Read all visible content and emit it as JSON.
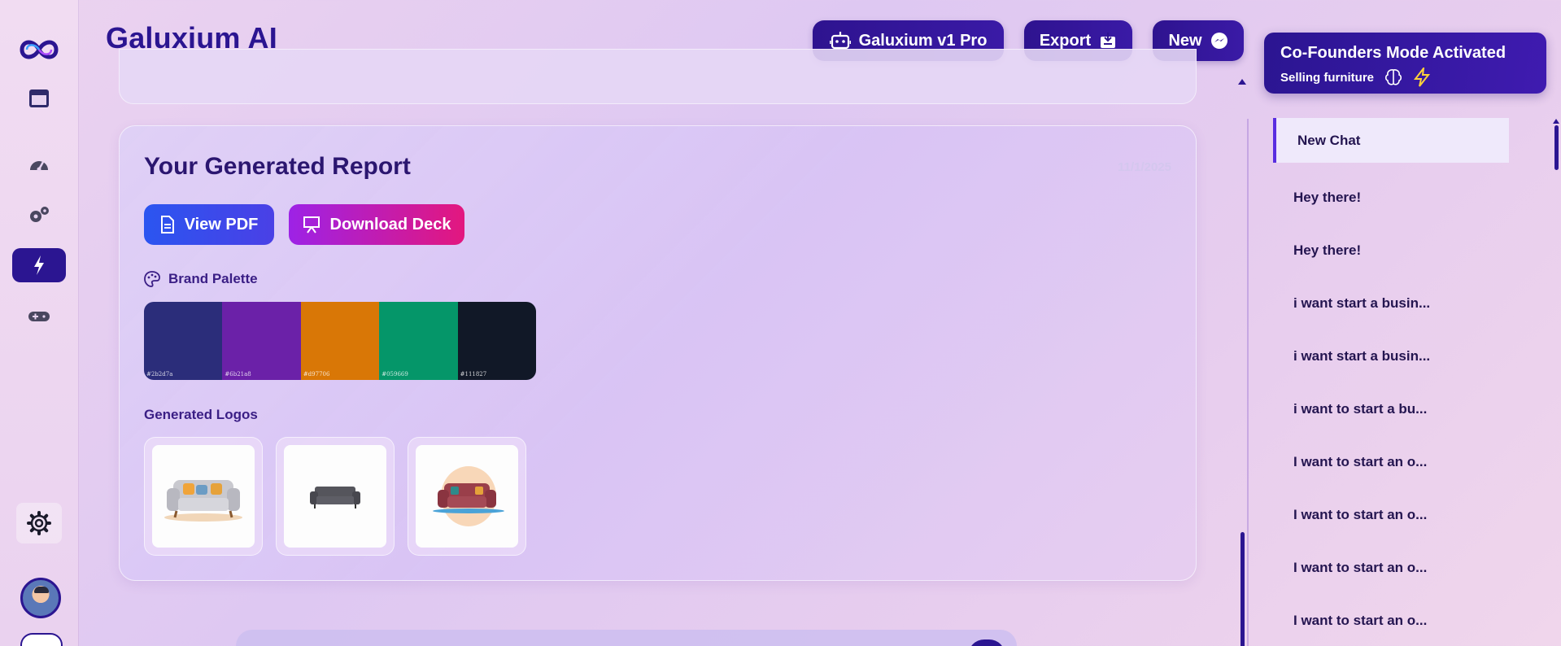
{
  "header": {
    "title": "Galuxium AI",
    "model_button": "Galuxium v1 Pro",
    "export_button": "Export",
    "new_button": "New"
  },
  "mode_banner": {
    "title": "Co-Founders Mode Activated",
    "subtitle": "Selling furniture"
  },
  "rail": {
    "icons": [
      "logo-icon",
      "panel-icon",
      "dashboard-icon",
      "gears-icon",
      "lightning-icon",
      "gamepad-icon",
      "settings-icon"
    ],
    "active": "lightning-icon"
  },
  "report": {
    "title": "Your Generated Report",
    "date": "11/1/2025",
    "view_pdf": "View PDF",
    "download_deck": "Download Deck",
    "palette_label": "Brand Palette",
    "palette": [
      {
        "hex": "#2b2d7a",
        "label": "#2b2d7a"
      },
      {
        "hex": "#6b21a8",
        "label": "#6b21a8"
      },
      {
        "hex": "#d97706",
        "label": "#d97706"
      },
      {
        "hex": "#059669",
        "label": "#059669"
      },
      {
        "hex": "#111827",
        "label": "#111827"
      }
    ],
    "logos_label": "Generated Logos"
  },
  "chat_history": {
    "items": [
      "New Chat",
      "Hey there!",
      "Hey there!",
      "i want start a busin...",
      "i want start a busin...",
      "i want to start a bu...",
      "I want to start an o...",
      "I want to start an o...",
      "I want to start an o...",
      "I want to start an o..."
    ]
  }
}
